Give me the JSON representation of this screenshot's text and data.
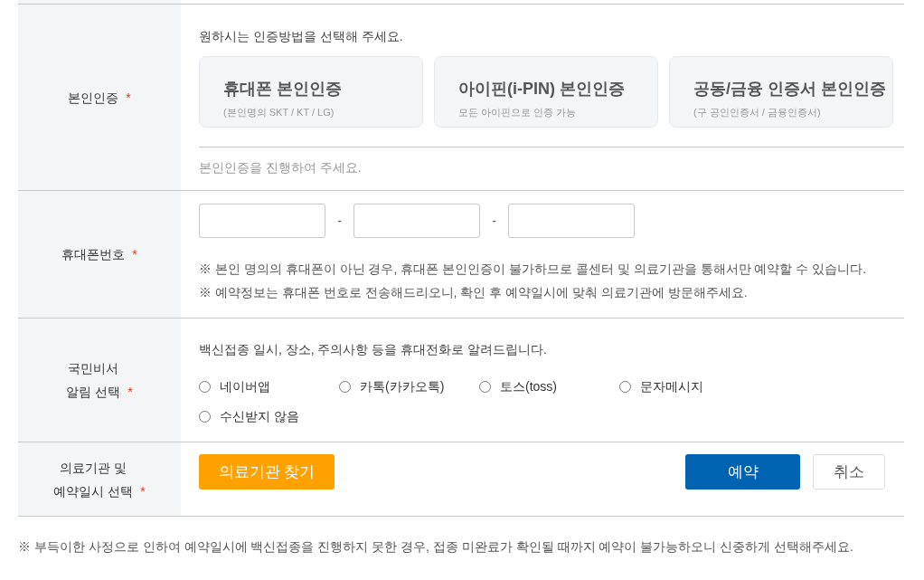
{
  "form_rows": [
    {
      "kind": "identity",
      "label_lines": [
        "본인인증"
      ],
      "required_mark": "*",
      "prompt": "원하시는 인증방법을 선택해 주세요.",
      "methods": [
        {
          "title": "휴대폰 본인인증",
          "subtitle": "(본인명의 SKT / KT / LG)",
          "selected": false
        },
        {
          "title": "아이핀(i-PIN) 본인인증",
          "subtitle": "모든 아이핀으로 인증 가능",
          "selected": false
        },
        {
          "title": "공동/금융 인증서 본인인증",
          "subtitle": "(구 공인인증서 / 금융인증서)",
          "selected": false
        }
      ],
      "status": "본인인증을 진행하여 주세요."
    },
    {
      "kind": "phone",
      "label_lines": [
        "휴대폰번호"
      ],
      "required_mark": "*",
      "parts": [
        {
          "kind": "field"
        },
        {
          "kind": "separator",
          "text": "-"
        },
        {
          "kind": "field"
        },
        {
          "kind": "separator",
          "text": "-"
        },
        {
          "kind": "field"
        }
      ],
      "notes": [
        "※ 본인 명의의 휴대폰이 아닌 경우, 휴대폰 본인인증이 불가하므로 콜센터 및 의료기관을 통해서만 예약할 수 있습니다.",
        "※ 예약정보는 휴대폰 번호로 전송해드리오니, 확인 후 예약일시에 맞춰 의료기관에 방문해주세요."
      ]
    },
    {
      "kind": "notification",
      "label_lines": [
        "국민비서",
        "알림 선택"
      ],
      "required_mark": "*",
      "prompt": "백신접종 일시, 장소, 주의사항 등을 휴대전화로 알려드립니다.",
      "options": [
        {
          "label": "네이버앱",
          "selected": false
        },
        {
          "label": "카톡(카카오톡)",
          "selected": false
        },
        {
          "label": "토스(toss)",
          "selected": false
        },
        {
          "label": "문자메시지",
          "selected": false
        },
        {
          "label": "수신받지 않음",
          "selected": false
        }
      ]
    },
    {
      "kind": "booking",
      "label_lines": [
        "의료기관 및",
        "예약일시 선택"
      ],
      "required_mark": "*",
      "buttons": [
        {
          "kind": "find",
          "text": "의료기관 찾기"
        },
        {
          "kind": "primary",
          "text": "예약"
        },
        {
          "kind": "secondary",
          "text": "취소"
        }
      ]
    }
  ],
  "footer_note": "※ 부득이한 사정으로 인하여 예약일시에 백신접종을 진행하지 못한 경우, 접종 미완료가 확인될 때까지 예약이 불가능하오니 신중하게 선택해주세요."
}
